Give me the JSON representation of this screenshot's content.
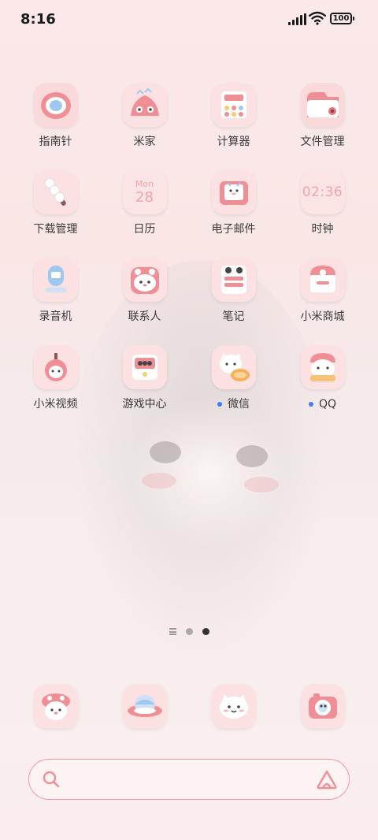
{
  "status_bar": {
    "time": "8:16",
    "battery": "100"
  },
  "apps": [
    {
      "label": "指南针",
      "icon": "compass-icon"
    },
    {
      "label": "米家",
      "icon": "mijia-icon"
    },
    {
      "label": "计算器",
      "icon": "calculator-icon"
    },
    {
      "label": "文件管理",
      "icon": "file-manager-icon"
    },
    {
      "label": "下载管理",
      "icon": "download-icon"
    },
    {
      "label": "日历",
      "icon": "calendar-icon",
      "day": "Mon",
      "date": "28"
    },
    {
      "label": "电子邮件",
      "icon": "email-icon"
    },
    {
      "label": "时钟",
      "icon": "clock-icon",
      "time": "02:36"
    },
    {
      "label": "录音机",
      "icon": "recorder-icon"
    },
    {
      "label": "联系人",
      "icon": "contacts-icon"
    },
    {
      "label": "笔记",
      "icon": "notes-icon"
    },
    {
      "label": "小米商城",
      "icon": "mi-store-icon"
    },
    {
      "label": "小米视频",
      "icon": "mi-video-icon"
    },
    {
      "label": "游戏中心",
      "icon": "game-center-icon"
    },
    {
      "label": "微信",
      "icon": "wechat-icon",
      "new_dot": true
    },
    {
      "label": "QQ",
      "icon": "qq-icon",
      "new_dot": true
    }
  ],
  "dock": [
    {
      "icon": "phone-icon"
    },
    {
      "icon": "browser-icon"
    },
    {
      "icon": "messages-icon"
    },
    {
      "icon": "camera-icon"
    }
  ],
  "search": {
    "placeholder": ""
  },
  "colors": {
    "accent": "#f08e96",
    "icon_bg": "#fbdfe0",
    "new_dot": "#3b7bff"
  }
}
